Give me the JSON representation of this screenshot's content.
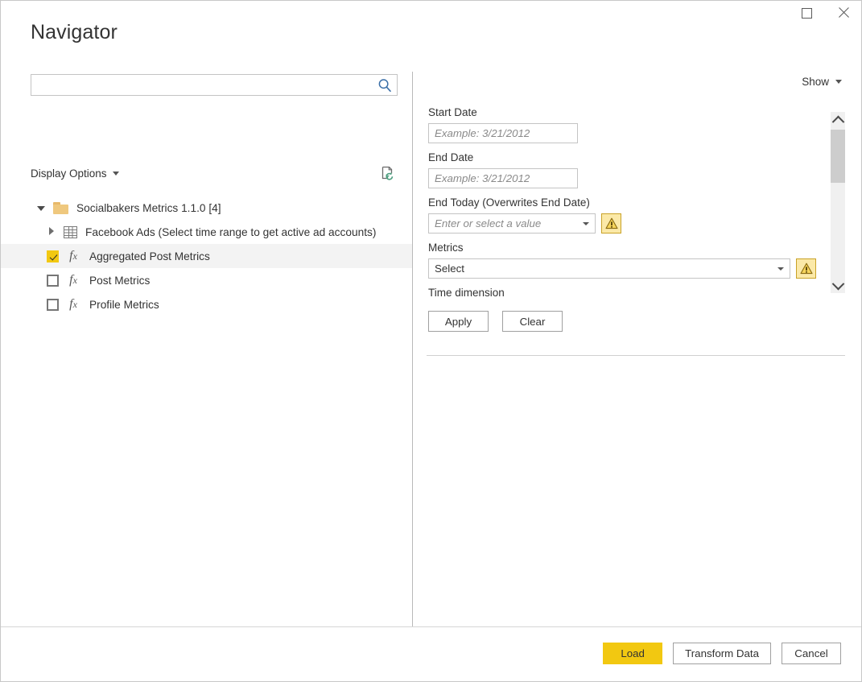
{
  "window": {
    "title": "Navigator",
    "maximize_icon": "maximize-icon",
    "close_icon": "close-icon"
  },
  "left": {
    "search": {
      "value": "",
      "placeholder": "",
      "icon": "search-icon"
    },
    "display_options_label": "Display Options",
    "refresh_icon": "refresh-document-icon",
    "tree": [
      {
        "label": "Socialbakers Metrics 1.1.0 [4]",
        "icon": "folder-icon",
        "expander": "open",
        "level": 0,
        "selected": false,
        "checkbox": null
      },
      {
        "label": "Facebook Ads (Select time range to get active ad accounts)",
        "icon": "table-icon",
        "expander": "closed",
        "level": 1,
        "selected": false,
        "checkbox": null
      },
      {
        "label": "Aggregated Post Metrics",
        "icon": "fx-icon",
        "expander": "none",
        "level": 1,
        "selected": true,
        "checkbox": "checked"
      },
      {
        "label": "Post Metrics",
        "icon": "fx-icon",
        "expander": "none",
        "level": 1,
        "selected": false,
        "checkbox": "unchecked"
      },
      {
        "label": "Profile Metrics",
        "icon": "fx-icon",
        "expander": "none",
        "level": 1,
        "selected": false,
        "checkbox": "unchecked"
      }
    ]
  },
  "right": {
    "show_label": "Show",
    "fields": {
      "start_date": {
        "label": "Start Date",
        "value": "",
        "placeholder": "Example: 3/21/2012"
      },
      "end_date": {
        "label": "End Date",
        "value": "",
        "placeholder": "Example: 3/21/2012"
      },
      "end_today": {
        "label": "End Today (Overwrites End Date)",
        "value": "Enter or select a value",
        "is_placeholder": true,
        "warning_icon": "warning-icon"
      },
      "metrics": {
        "label": "Metrics",
        "value": "Select",
        "is_placeholder": false,
        "warning_icon": "warning-icon"
      },
      "time_dimension": {
        "label": "Time dimension"
      }
    },
    "apply_label": "Apply",
    "clear_label": "Clear",
    "scrollbar": {
      "up_icon": "chevron-up-icon",
      "down_icon": "chevron-down-icon"
    }
  },
  "footer": {
    "load_label": "Load",
    "transform_label": "Transform Data",
    "cancel_label": "Cancel"
  },
  "colors": {
    "accent": "#f2c811",
    "warning_bg": "#fbe9a8",
    "warning_border": "#c9a227",
    "folder": "#efc87e",
    "search_icon": "#3a6fa8",
    "text": "#333333"
  }
}
